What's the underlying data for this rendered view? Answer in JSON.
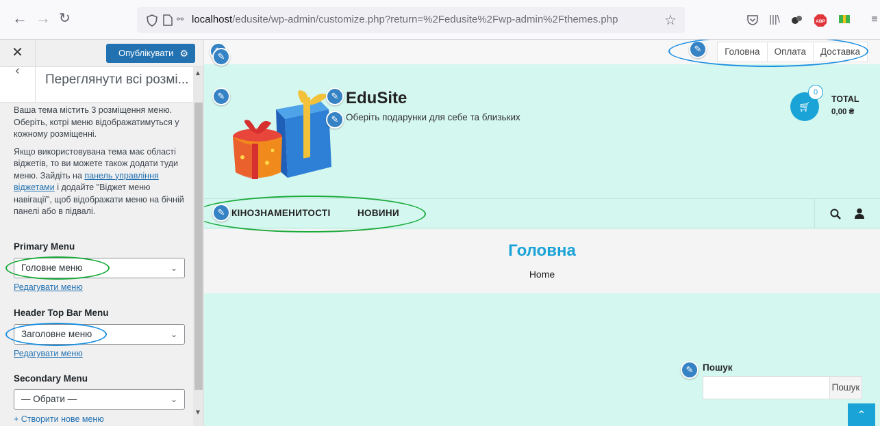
{
  "browser": {
    "url_host": "localhost",
    "url_path": "/edusite/wp-admin/customize.php?return=%2Fedusite%2Fwp-admin%2Fthemes.php"
  },
  "customizer": {
    "publish_label": "Опублікувати",
    "section_title": "Переглянути всі розмі...",
    "desc1": "Ваша тема містить 3 розміщення меню. Оберіть, котрі меню відображатимуться у кожному розміщенні.",
    "desc2_before": "Якщо використовувана тема має області віджетів, то ви можете також додати туди меню. Зайдіть на ",
    "desc2_link": "панель управління віджетами",
    "desc2_after": " і додайте \"Віджет меню навігації\", щоб відображати меню на бічній панелі або в підвалі.",
    "locations": [
      {
        "label": "Primary Menu",
        "selected": "Головне меню",
        "edit": "Редагувати меню"
      },
      {
        "label": "Header Top Bar Menu",
        "selected": "Заголовне меню",
        "edit": "Редагувати меню"
      },
      {
        "label": "Secondary Menu",
        "selected": "— Обрати —",
        "edit": ""
      }
    ],
    "create_link": "+ Створити нове меню"
  },
  "site": {
    "top_menu": [
      "Головна",
      "Оплата",
      "Доставка"
    ],
    "title": "EduSite",
    "tagline": "Оберіть подарунки для себе та близьких",
    "cart_count": "0",
    "total_label": "TOTAL",
    "total_value": "0,00 ₴",
    "primary_menu": [
      "КІНОЗНАМЕНИТОСТІ",
      "НОВИНИ"
    ],
    "page_title": "Головна",
    "breadcrumb": "Home",
    "search_label": "Пошук",
    "search_button": "Пошук"
  },
  "colors": {
    "accent": "#1aa3d7",
    "publish": "#2271b1",
    "preview_bg": "#d4f7ef",
    "annotation_blue": "#1a8fe0",
    "annotation_green": "#1aaa3a"
  }
}
